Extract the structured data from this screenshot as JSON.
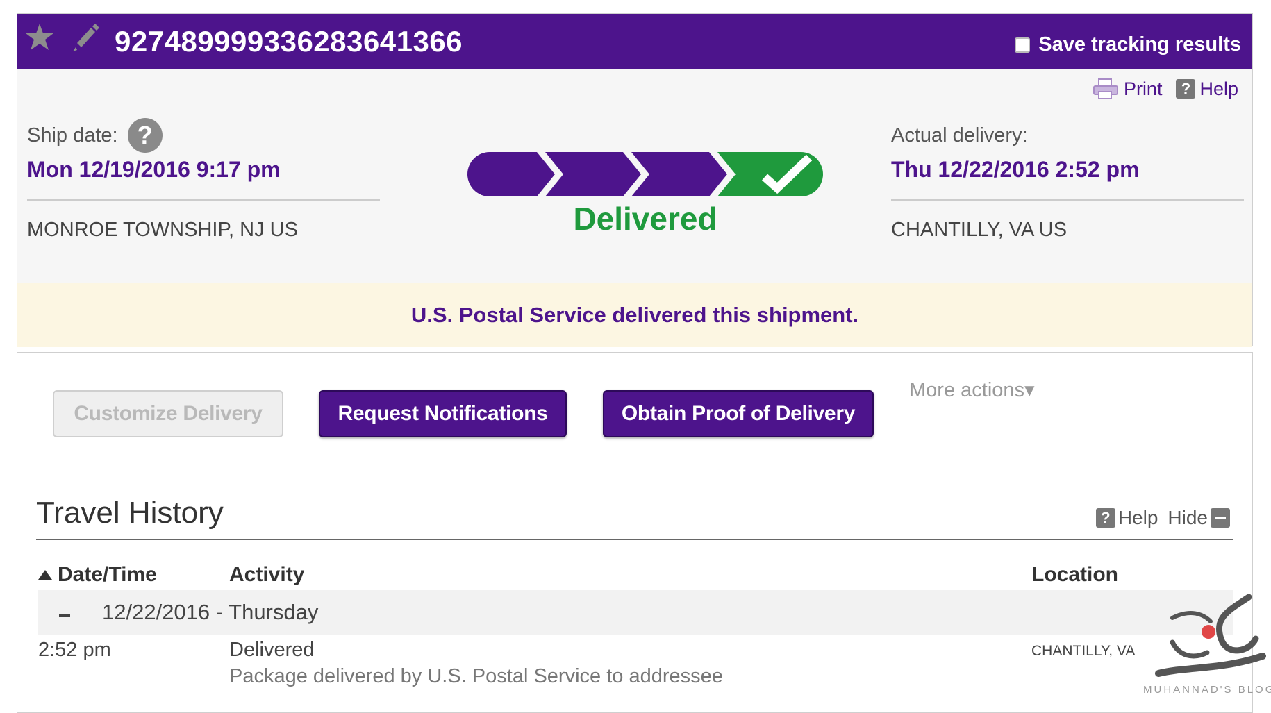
{
  "header": {
    "tracking_number": "927489999336283641366",
    "save_label": "Save tracking results",
    "star_icon": "star-icon",
    "edit_icon": "pencil-icon"
  },
  "tools": {
    "print_label": "Print",
    "help_label": "Help",
    "help_glyph": "?"
  },
  "shipment": {
    "ship_date_label": "Ship date:",
    "ship_date_help_glyph": "?",
    "ship_date": "Mon 12/19/2016 9:17 pm",
    "origin": "MONROE TOWNSHIP, NJ US",
    "actual_delivery_label": "Actual delivery:",
    "actual_delivery": "Thu 12/22/2016 2:52 pm",
    "destination": "CHANTILLY, VA US",
    "status": "Delivered",
    "progress_steps_completed": 4,
    "progress_steps_total": 4
  },
  "banner": {
    "message": "U.S. Postal Service delivered this shipment."
  },
  "actions": {
    "customize_delivery": "Customize Delivery",
    "request_notifications": "Request Notifications",
    "obtain_proof": "Obtain Proof of Delivery",
    "more_actions": "More actions▾"
  },
  "travel_history": {
    "title": "Travel History",
    "help_label": "Help",
    "help_glyph": "?",
    "hide_label": "Hide",
    "columns": {
      "date_time": "Date/Time",
      "activity": "Activity",
      "location": "Location"
    },
    "days": [
      {
        "heading": "12/22/2016 - Thursday",
        "events": [
          {
            "time": "2:52 pm",
            "activity": "Delivered",
            "description": "Package delivered by U.S. Postal Service to addressee",
            "location": "CHANTILLY, VA"
          }
        ]
      }
    ]
  },
  "colors": {
    "brand_purple": "#4d148c",
    "delivered_green": "#1f9a3d",
    "banner_bg": "#fcf6e2"
  },
  "watermark": {
    "text": "MUHANNAD'S BLOG"
  }
}
